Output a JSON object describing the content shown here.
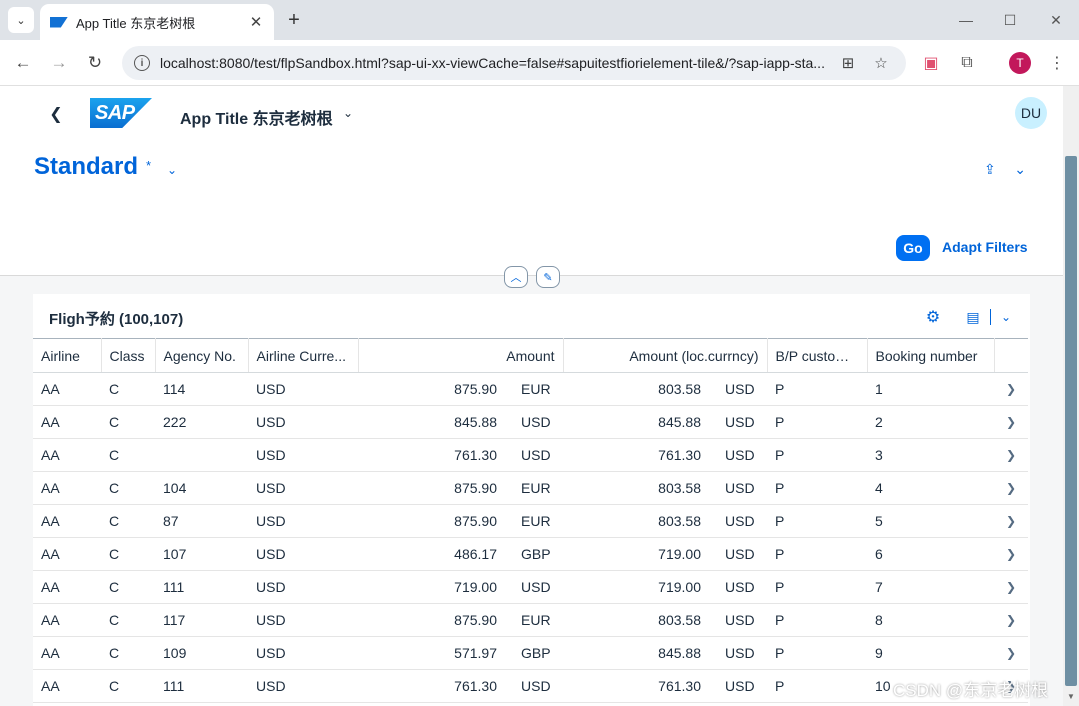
{
  "browser": {
    "tab_title": "App Title 东京老树根",
    "url": "localhost:8080/test/flpSandbox.html?sap-ui-xx-viewCache=false#sapuitestfiorielement-tile&/?sap-iapp-sta...",
    "profile_initial": "T"
  },
  "shell": {
    "logo_text": "SAP",
    "app_title": "App Title 东京老树根",
    "avatar_initials": "DU"
  },
  "filterbar": {
    "variant_name": "Standard",
    "variant_modified": "*",
    "go_label": "Go",
    "adapt_filters_label": "Adapt Filters"
  },
  "table": {
    "title": "Fligh予約 (100,107)",
    "columns": [
      "Airline",
      "Class",
      "Agency No.",
      "Airline Curre...",
      "Amount",
      "Amount (loc.currncy)",
      "B/P customer",
      "Booking number"
    ],
    "rows": [
      {
        "airline": "AA",
        "class": "C",
        "agency": "114",
        "airline_curr": "USD",
        "amount": "875.90",
        "amount_curr": "EUR",
        "loc_amount": "803.58",
        "loc_curr": "USD",
        "bp": "P",
        "booking": "1"
      },
      {
        "airline": "AA",
        "class": "C",
        "agency": "222",
        "airline_curr": "USD",
        "amount": "845.88",
        "amount_curr": "USD",
        "loc_amount": "845.88",
        "loc_curr": "USD",
        "bp": "P",
        "booking": "2"
      },
      {
        "airline": "AA",
        "class": "C",
        "agency": "",
        "airline_curr": "USD",
        "amount": "761.30",
        "amount_curr": "USD",
        "loc_amount": "761.30",
        "loc_curr": "USD",
        "bp": "P",
        "booking": "3"
      },
      {
        "airline": "AA",
        "class": "C",
        "agency": "104",
        "airline_curr": "USD",
        "amount": "875.90",
        "amount_curr": "EUR",
        "loc_amount": "803.58",
        "loc_curr": "USD",
        "bp": "P",
        "booking": "4"
      },
      {
        "airline": "AA",
        "class": "C",
        "agency": "87",
        "airline_curr": "USD",
        "amount": "875.90",
        "amount_curr": "EUR",
        "loc_amount": "803.58",
        "loc_curr": "USD",
        "bp": "P",
        "booking": "5"
      },
      {
        "airline": "AA",
        "class": "C",
        "agency": "107",
        "airline_curr": "USD",
        "amount": "486.17",
        "amount_curr": "GBP",
        "loc_amount": "719.00",
        "loc_curr": "USD",
        "bp": "P",
        "booking": "6"
      },
      {
        "airline": "AA",
        "class": "C",
        "agency": "111",
        "airline_curr": "USD",
        "amount": "719.00",
        "amount_curr": "USD",
        "loc_amount": "719.00",
        "loc_curr": "USD",
        "bp": "P",
        "booking": "7"
      },
      {
        "airline": "AA",
        "class": "C",
        "agency": "117",
        "airline_curr": "USD",
        "amount": "875.90",
        "amount_curr": "EUR",
        "loc_amount": "803.58",
        "loc_curr": "USD",
        "bp": "P",
        "booking": "8"
      },
      {
        "airline": "AA",
        "class": "C",
        "agency": "109",
        "airline_curr": "USD",
        "amount": "571.97",
        "amount_curr": "GBP",
        "loc_amount": "845.88",
        "loc_curr": "USD",
        "bp": "P",
        "booking": "9"
      },
      {
        "airline": "AA",
        "class": "C",
        "agency": "111",
        "airline_curr": "USD",
        "amount": "761.30",
        "amount_curr": "USD",
        "loc_amount": "761.30",
        "loc_curr": "USD",
        "bp": "P",
        "booking": "10"
      }
    ]
  },
  "watermark": "CSDN @东京老树根",
  "icons": {
    "tab_search": "chevron-down-icon",
    "back": "arrow-left-icon",
    "forward": "arrow-right-icon",
    "reload": "reload-icon",
    "site_info": "info-icon",
    "translate": "translate-icon",
    "bookmark": "star-icon",
    "extension_bilibili": "tv-icon",
    "extensions": "puzzle-icon",
    "menu": "kebab-icon",
    "settings": "gear-icon",
    "export": "spreadsheet-icon",
    "share": "share-icon",
    "pin": "pin-icon",
    "collapse": "chevron-up-icon",
    "row_nav": "chevron-right-icon"
  },
  "colors": {
    "brand_blue": "#0064d9",
    "go_button": "#0070f2",
    "avatar_bg": "#c9f0ff",
    "profile_bg": "#c2185b",
    "scroll_thumb": "#6e8fa3"
  }
}
